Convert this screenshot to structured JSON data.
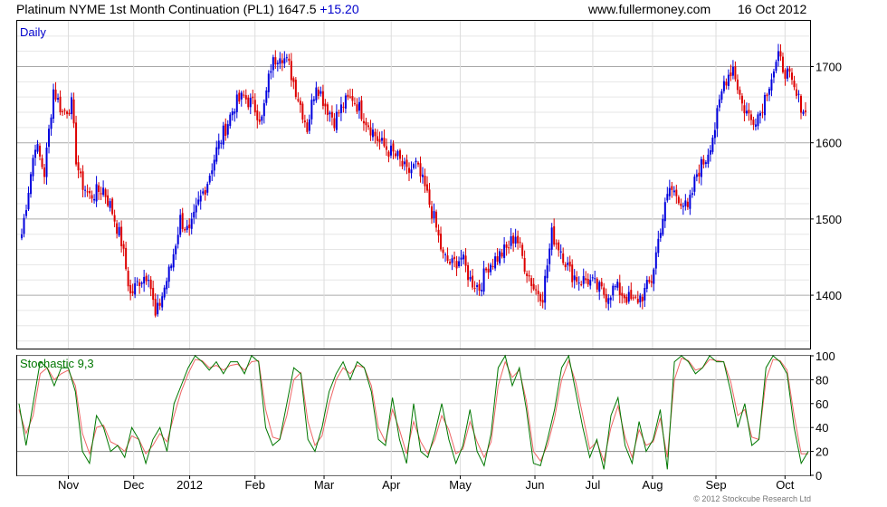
{
  "header": {
    "title": "Platinum NYME 1st Month Continuation (PL1)",
    "price": "1647.5",
    "change": "+15.20",
    "site": "www.fullermoney.com",
    "date": "16 Oct 2012"
  },
  "footer": "© 2012 Stockcube Research Ltd",
  "colors": {
    "up": "#0000dd",
    "down": "#dd0000",
    "stoch_k": "#007700",
    "stoch_d": "#ee6666",
    "grid": "#bbbbbb"
  },
  "chart_data": [
    {
      "type": "candlestick",
      "title": "Daily",
      "ylim": [
        1330,
        1760
      ],
      "yticks": [
        1400,
        1500,
        1600,
        1700
      ],
      "grid": true,
      "x_labels": [
        "Nov",
        "Dec",
        "2012",
        "Feb",
        "Mar",
        "Apr",
        "May",
        "Jun",
        "Jul",
        "Aug",
        "Sep",
        "Oct"
      ],
      "close_path": [
        [
          0,
          1480
        ],
        [
          6,
          1600
        ],
        [
          10,
          1560
        ],
        [
          14,
          1670
        ],
        [
          18,
          1640
        ],
        [
          22,
          1650
        ],
        [
          24,
          1580
        ],
        [
          26,
          1550
        ],
        [
          30,
          1530
        ],
        [
          36,
          1540
        ],
        [
          40,
          1510
        ],
        [
          44,
          1470
        ],
        [
          48,
          1400
        ],
        [
          52,
          1420
        ],
        [
          56,
          1430
        ],
        [
          59,
          1370
        ],
        [
          62,
          1400
        ],
        [
          66,
          1440
        ],
        [
          70,
          1500
        ],
        [
          74,
          1480
        ],
        [
          78,
          1520
        ],
        [
          82,
          1550
        ],
        [
          86,
          1590
        ],
        [
          90,
          1620
        ],
        [
          94,
          1650
        ],
        [
          98,
          1660
        ],
        [
          102,
          1650
        ],
        [
          106,
          1630
        ],
        [
          110,
          1700
        ],
        [
          114,
          1720
        ],
        [
          118,
          1700
        ],
        [
          122,
          1660
        ],
        [
          126,
          1620
        ],
        [
          130,
          1680
        ],
        [
          134,
          1650
        ],
        [
          138,
          1630
        ],
        [
          142,
          1650
        ],
        [
          146,
          1660
        ],
        [
          150,
          1640
        ],
        [
          154,
          1620
        ],
        [
          158,
          1600
        ],
        [
          162,
          1590
        ],
        [
          166,
          1580
        ],
        [
          170,
          1560
        ],
        [
          174,
          1570
        ],
        [
          178,
          1540
        ],
        [
          182,
          1500
        ],
        [
          186,
          1450
        ],
        [
          190,
          1440
        ],
        [
          194,
          1450
        ],
        [
          198,
          1420
        ],
        [
          202,
          1410
        ],
        [
          206,
          1440
        ],
        [
          210,
          1450
        ],
        [
          214,
          1460
        ],
        [
          218,
          1480
        ],
        [
          222,
          1440
        ],
        [
          226,
          1410
        ],
        [
          230,
          1400
        ],
        [
          234,
          1480
        ],
        [
          238,
          1460
        ],
        [
          242,
          1430
        ],
        [
          246,
          1420
        ],
        [
          250,
          1420
        ],
        [
          254,
          1410
        ],
        [
          258,
          1400
        ],
        [
          262,
          1410
        ],
        [
          266,
          1400
        ],
        [
          270,
          1390
        ],
        [
          274,
          1400
        ],
        [
          278,
          1420
        ],
        [
          282,
          1490
        ],
        [
          286,
          1540
        ],
        [
          290,
          1530
        ],
        [
          294,
          1510
        ],
        [
          298,
          1560
        ],
        [
          302,
          1580
        ],
        [
          306,
          1620
        ],
        [
          310,
          1680
        ],
        [
          314,
          1700
        ],
        [
          318,
          1650
        ],
        [
          322,
          1630
        ],
        [
          326,
          1640
        ],
        [
          330,
          1680
        ],
        [
          334,
          1710
        ],
        [
          338,
          1690
        ],
        [
          342,
          1660
        ],
        [
          346,
          1640
        ]
      ]
    },
    {
      "type": "line",
      "title": "Stochastic 9,3",
      "ylim": [
        0,
        100
      ],
      "yticks": [
        0,
        20,
        40,
        60,
        80,
        100
      ],
      "grid": true,
      "series": [
        {
          "key": "k",
          "values": [
            60,
            25,
            60,
            95,
            90,
            75,
            90,
            90,
            70,
            20,
            10,
            50,
            40,
            20,
            25,
            15,
            40,
            30,
            10,
            30,
            40,
            20,
            60,
            75,
            90,
            100,
            95,
            88,
            95,
            85,
            95,
            95,
            85,
            100,
            95,
            40,
            25,
            30,
            60,
            90,
            85,
            30,
            20,
            40,
            70,
            85,
            95,
            80,
            95,
            90,
            70,
            30,
            25,
            65,
            30,
            10,
            60,
            20,
            15,
            35,
            60,
            30,
            10,
            25,
            55,
            20,
            8,
            35,
            90,
            100,
            75,
            90,
            55,
            10,
            8,
            30,
            55,
            90,
            100,
            70,
            40,
            15,
            30,
            5,
            50,
            65,
            25,
            10,
            45,
            20,
            30,
            55,
            5,
            95,
            100,
            95,
            85,
            90,
            100,
            95,
            95,
            70,
            40,
            60,
            25,
            30,
            90,
            100,
            95,
            85,
            40,
            10,
            20
          ]
        },
        {
          "key": "d",
          "values": [
            55,
            35,
            50,
            85,
            90,
            80,
            85,
            88,
            75,
            35,
            18,
            40,
            42,
            28,
            25,
            20,
            33,
            30,
            18,
            25,
            35,
            28,
            50,
            70,
            85,
            97,
            96,
            90,
            92,
            88,
            92,
            93,
            88,
            95,
            96,
            55,
            32,
            30,
            50,
            80,
            86,
            45,
            25,
            33,
            60,
            80,
            90,
            85,
            92,
            90,
            75,
            40,
            28,
            55,
            38,
            18,
            45,
            28,
            18,
            30,
            50,
            38,
            18,
            22,
            45,
            28,
            15,
            28,
            75,
            95,
            82,
            88,
            62,
            20,
            12,
            25,
            48,
            80,
            96,
            78,
            50,
            22,
            28,
            12,
            40,
            58,
            32,
            15,
            38,
            25,
            28,
            48,
            15,
            80,
            98,
            96,
            88,
            90,
            97,
            96,
            95,
            78,
            50,
            55,
            32,
            30,
            80,
            97,
            96,
            88,
            50,
            18,
            18
          ]
        }
      ]
    }
  ]
}
